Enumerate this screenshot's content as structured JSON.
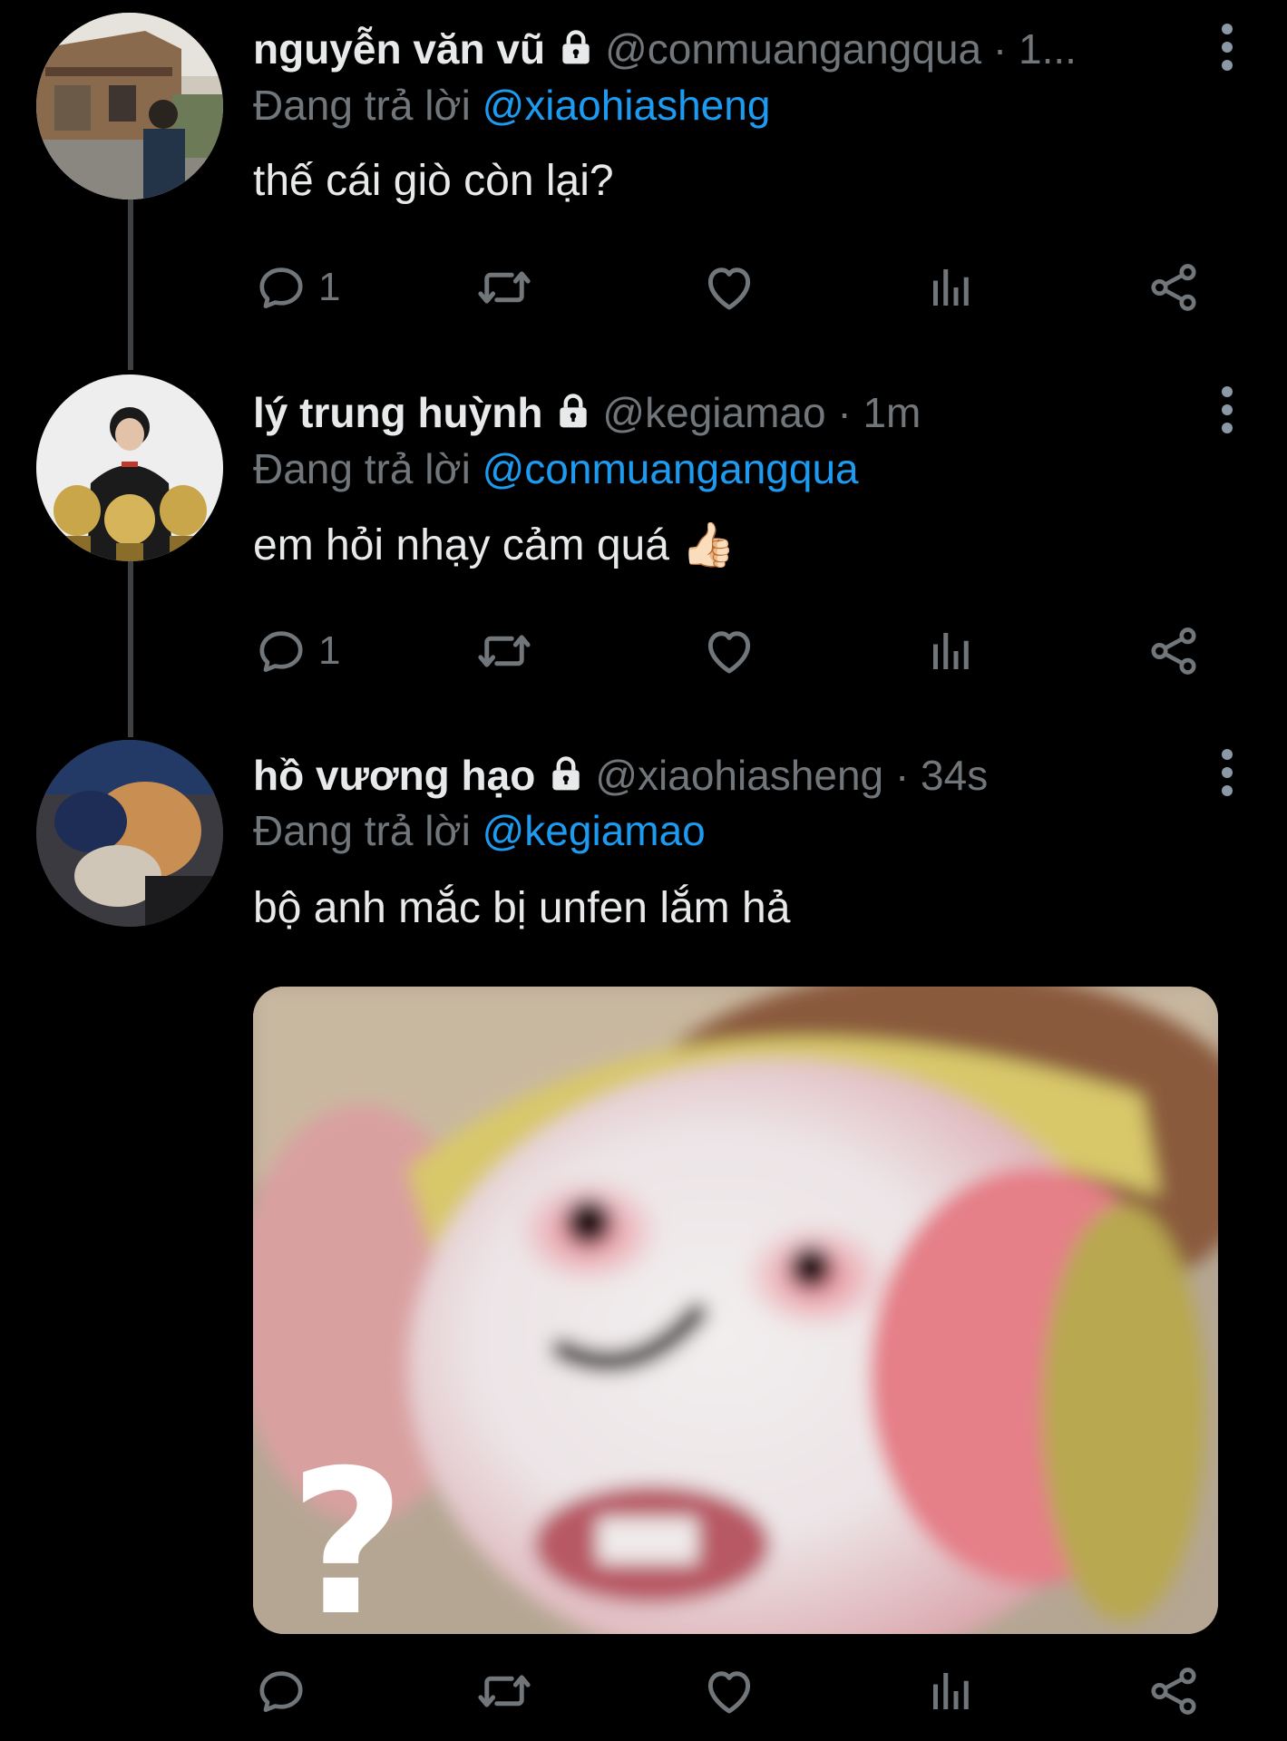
{
  "tweets": [
    {
      "display_name": "nguyễn văn vũ",
      "handle": "@conmuangangqua",
      "dot": "·",
      "time": "1...",
      "replying_prefix": "Đang trả lời",
      "replying_to": "@xiaohiasheng",
      "text": "thế cái giò còn lại?",
      "reply_count": "1",
      "retweet_count": "",
      "like_count": ""
    },
    {
      "display_name": "lý trung huỳnh",
      "handle": "@kegiamao",
      "dot": "·",
      "time": "1m",
      "replying_prefix": "Đang trả lời",
      "replying_to": "@conmuangangqua",
      "text": "em hỏi nhạy cảm quá 👍🏻",
      "reply_count": "1",
      "retweet_count": "",
      "like_count": ""
    },
    {
      "display_name": "hồ vương hạo",
      "handle": "@xiaohiasheng",
      "dot": "·",
      "time": "34s",
      "replying_prefix": "Đang trả lời",
      "replying_to": "@kegiamao",
      "text": "bộ anh mắc bị unfen lắm hả",
      "media_overlay_text": "?",
      "reply_count": "",
      "retweet_count": "",
      "like_count": ""
    }
  ],
  "icons": {
    "lock": "lock-icon",
    "more": "more-vertical-icon",
    "reply": "reply-icon",
    "retweet": "retweet-icon",
    "like": "heart-icon",
    "views": "views-icon",
    "share": "share-icon"
  },
  "colors": {
    "background": "#000000",
    "text_primary": "#e7e9ea",
    "text_secondary": "#71767b",
    "mention": "#1d9bf0",
    "thread_line": "#3e4144"
  }
}
